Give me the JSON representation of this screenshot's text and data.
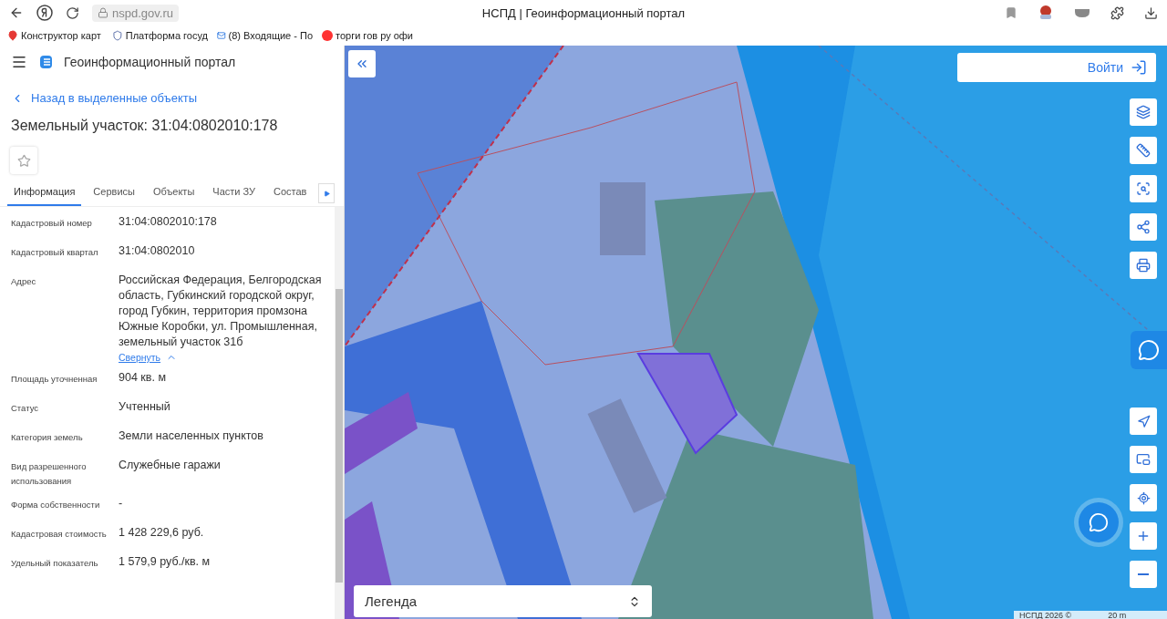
{
  "browser": {
    "url": "nspd.gov.ru",
    "title": "НСПД | Геоинформационный портал",
    "bookmarks": [
      {
        "label": "Конструктор карт",
        "kind": "pin"
      },
      {
        "label": "Платформа госуд",
        "kind": "emblem"
      },
      {
        "label": "(8) Входящие - По",
        "kind": "mail"
      },
      {
        "label": "торги гов ру офи",
        "kind": "ya"
      }
    ]
  },
  "app": {
    "title": "Геоинформационный портал"
  },
  "panel": {
    "back_link": "Назад в выделенные объекты",
    "heading": "Земельный участок: 31:04:0802010:178",
    "tabs": [
      {
        "label": "Информация",
        "selected": true
      },
      {
        "label": "Сервисы",
        "selected": false
      },
      {
        "label": "Объекты",
        "selected": false
      },
      {
        "label": "Части ЗУ",
        "selected": false
      },
      {
        "label": "Состав",
        "selected": false
      }
    ],
    "fields": [
      {
        "label": "Кадастровый номер",
        "value": "31:04:0802010:178"
      },
      {
        "label": "Кадастровый квартал",
        "value": "31:04:0802010"
      },
      {
        "label": "Адрес",
        "value": "Российская Федерация, Белгородская область, Губкинский городской округ, город Губкин, территория промзона Южные Коробки, ул. Промышленная, земельный участок 31б",
        "toggle": "Свернуть"
      },
      {
        "label": "Площадь уточненная",
        "value": "904 кв. м"
      },
      {
        "label": "Статус",
        "value": "Учтенный"
      },
      {
        "label": "Категория земель",
        "value": "Земли населенных пунктов"
      },
      {
        "label": "Вид разрешенного использования",
        "value": "Служебные гаражи"
      },
      {
        "label": "Форма собственности",
        "value": "-"
      },
      {
        "label": "Кадастровая стоимость",
        "value": "1 428 229,6 руб."
      },
      {
        "label": "Удельный показатель",
        "value": "1 579,9 руб./кв. м"
      }
    ]
  },
  "map": {
    "login": "Войти",
    "legend": "Легенда",
    "attribution": "НСПД 2026 ©",
    "scale": "20 m"
  }
}
